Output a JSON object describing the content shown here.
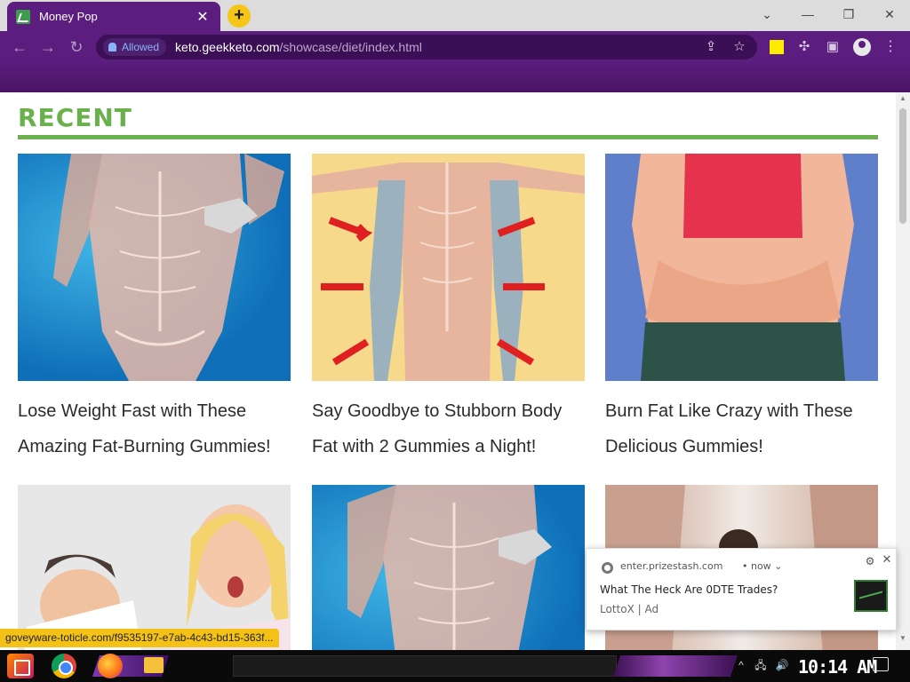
{
  "browser": {
    "tab_title": "Money Pop",
    "tab_close_label": "✕",
    "new_tab_label": "+",
    "window_controls": {
      "dropdown": "⌄",
      "minimize": "—",
      "restore": "❐",
      "close": "✕"
    },
    "nav": {
      "back": "←",
      "forward": "→",
      "reload": "↻"
    },
    "permission_chip": "Allowed",
    "url_host": "keto.geekketo.com",
    "url_path": "/showcase/diet/index.html",
    "share_icon": "⇪",
    "star_icon": "☆",
    "extensions_icon": "✣",
    "sidepanel_icon": "▣",
    "menu_icon": "⋮",
    "accent_color": "#5b1d7e"
  },
  "page": {
    "section_heading": "RECENT",
    "heading_color": "#6ab04c",
    "cards": [
      {
        "title": "Lose Weight Fast with These Amazing Fat-Burning Gummies!",
        "image": "muscular-torso-illustration"
      },
      {
        "title": "Say Goodbye to Stubborn Body Fat with 2 Gummies a Night!",
        "image": "body-contour-arrows-illustration"
      },
      {
        "title": "Burn Fat Like Crazy with These Delicious Gummies!",
        "image": "belly-fat-illustration"
      },
      {
        "title": "",
        "image": "surprised-couple-cartoon"
      },
      {
        "title": "",
        "image": "muscular-torso-illustration"
      },
      {
        "title": "",
        "image": "woman-photo"
      }
    ]
  },
  "status_bar": {
    "hover_url": "goveyware-toticle.com/f9535197-e7ab-4c43-bd15-363f..."
  },
  "notification": {
    "origin": "enter.prizestash.com",
    "when": "• now ⌄",
    "settings_icon": "⚙",
    "close_icon": "✕",
    "title": "What The Heck Are 0DTE Trades?",
    "subtitle": "LottoX | Ad"
  },
  "taskbar": {
    "clock": "10:14 AM",
    "tray_chevron": "^",
    "network_icon": "🖧",
    "volume_icon": "🔊"
  },
  "scrollbar": {
    "up": "▲",
    "down": "▼"
  }
}
